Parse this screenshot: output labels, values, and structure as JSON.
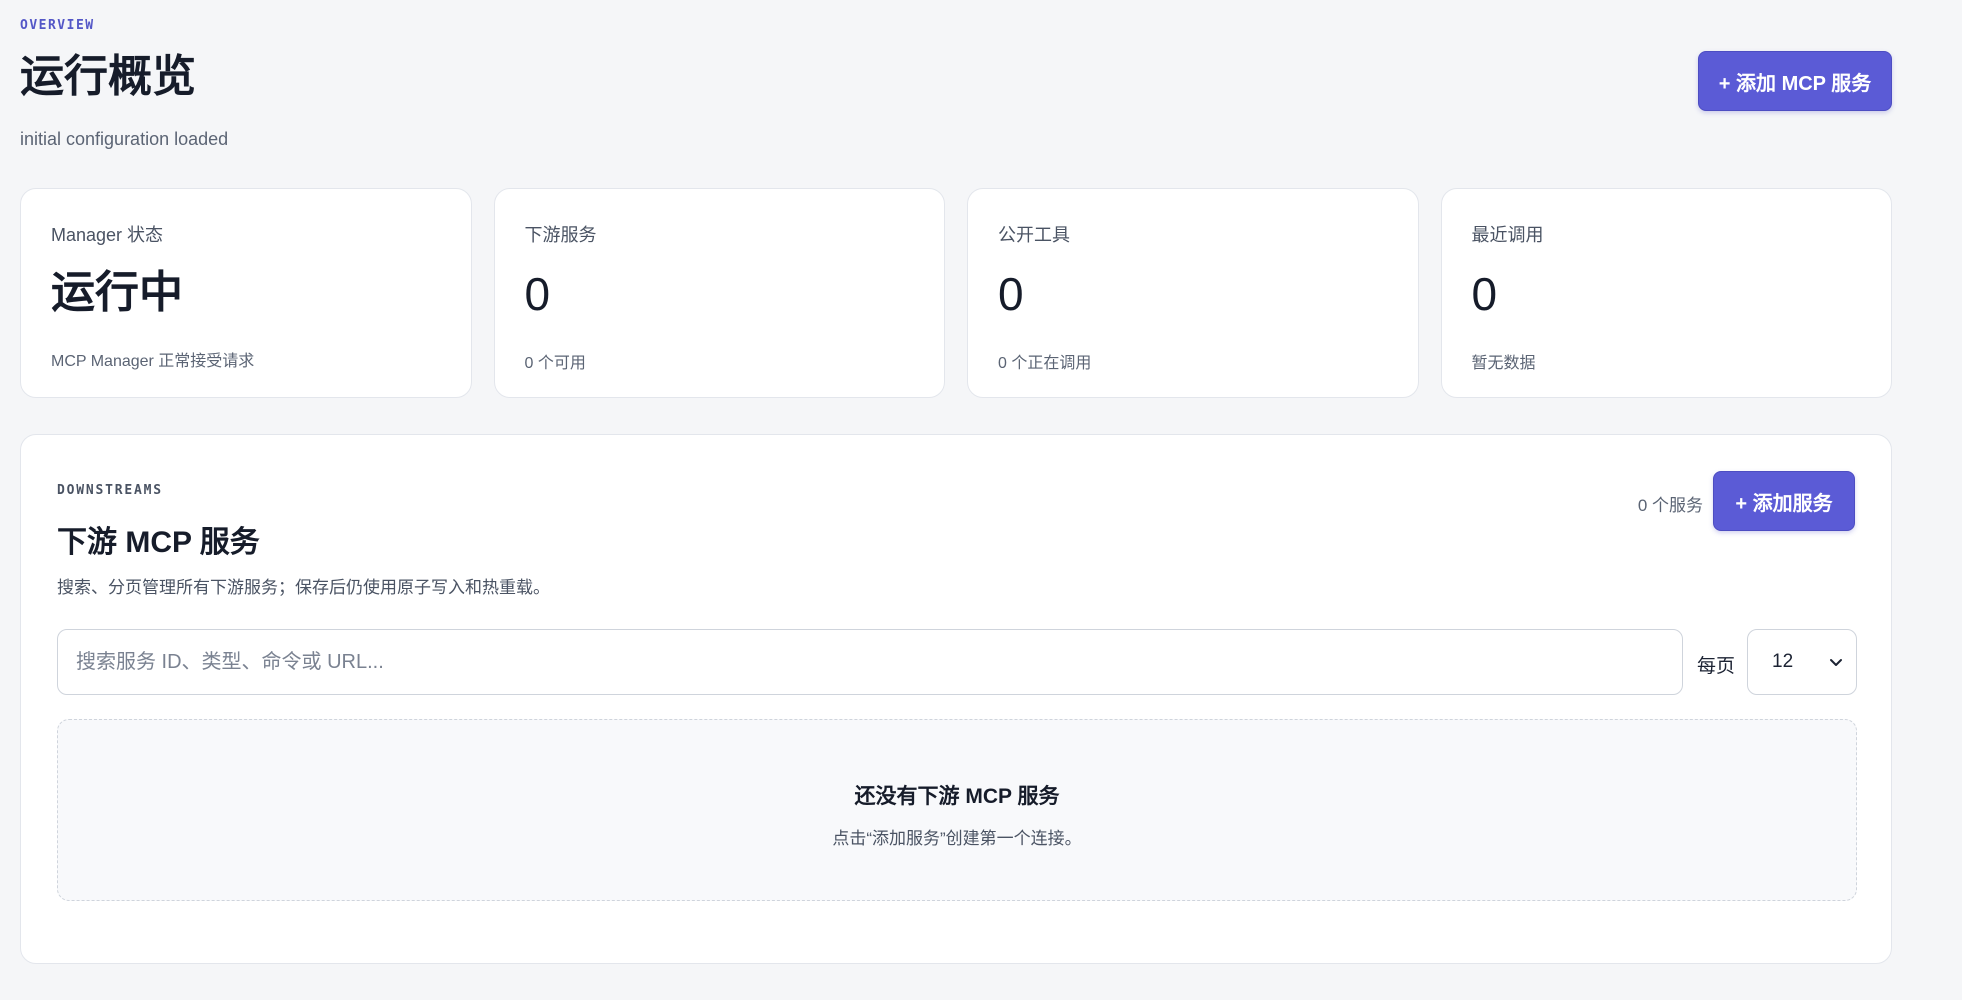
{
  "overview": {
    "eyebrow": "OVERVIEW",
    "title": "运行概览",
    "subtitle": "initial configuration loaded",
    "add_button_label": "+ 添加 MCP 服务"
  },
  "stats": [
    {
      "label": "Manager 状态",
      "value": "运行中",
      "note": "MCP Manager 正常接受请求"
    },
    {
      "label": "下游服务",
      "value": "0",
      "note": "0 个可用"
    },
    {
      "label": "公开工具",
      "value": "0",
      "note": "0 个正在调用"
    },
    {
      "label": "最近调用",
      "value": "0",
      "note": "暂无数据"
    }
  ],
  "downstreams": {
    "eyebrow": "DOWNSTREAMS",
    "title": "下游 MCP 服务",
    "description": "搜索、分页管理所有下游服务；保存后仍使用原子写入和热重载。",
    "count": "0 个服务",
    "add_button_label": "+ 添加服务",
    "search": {
      "placeholder": "搜索服务 ID、类型、命令或 URL...",
      "value": ""
    },
    "per_page_label": "每页",
    "per_page_value": "12",
    "empty": {
      "title": "还没有下游 MCP 服务",
      "description": "点击“添加服务”创建第一个连接。"
    }
  },
  "colors": {
    "accent": "#5b5bd6",
    "background": "#f5f6f8"
  },
  "icons": {
    "select_chevron": "chevron-down-icon"
  }
}
